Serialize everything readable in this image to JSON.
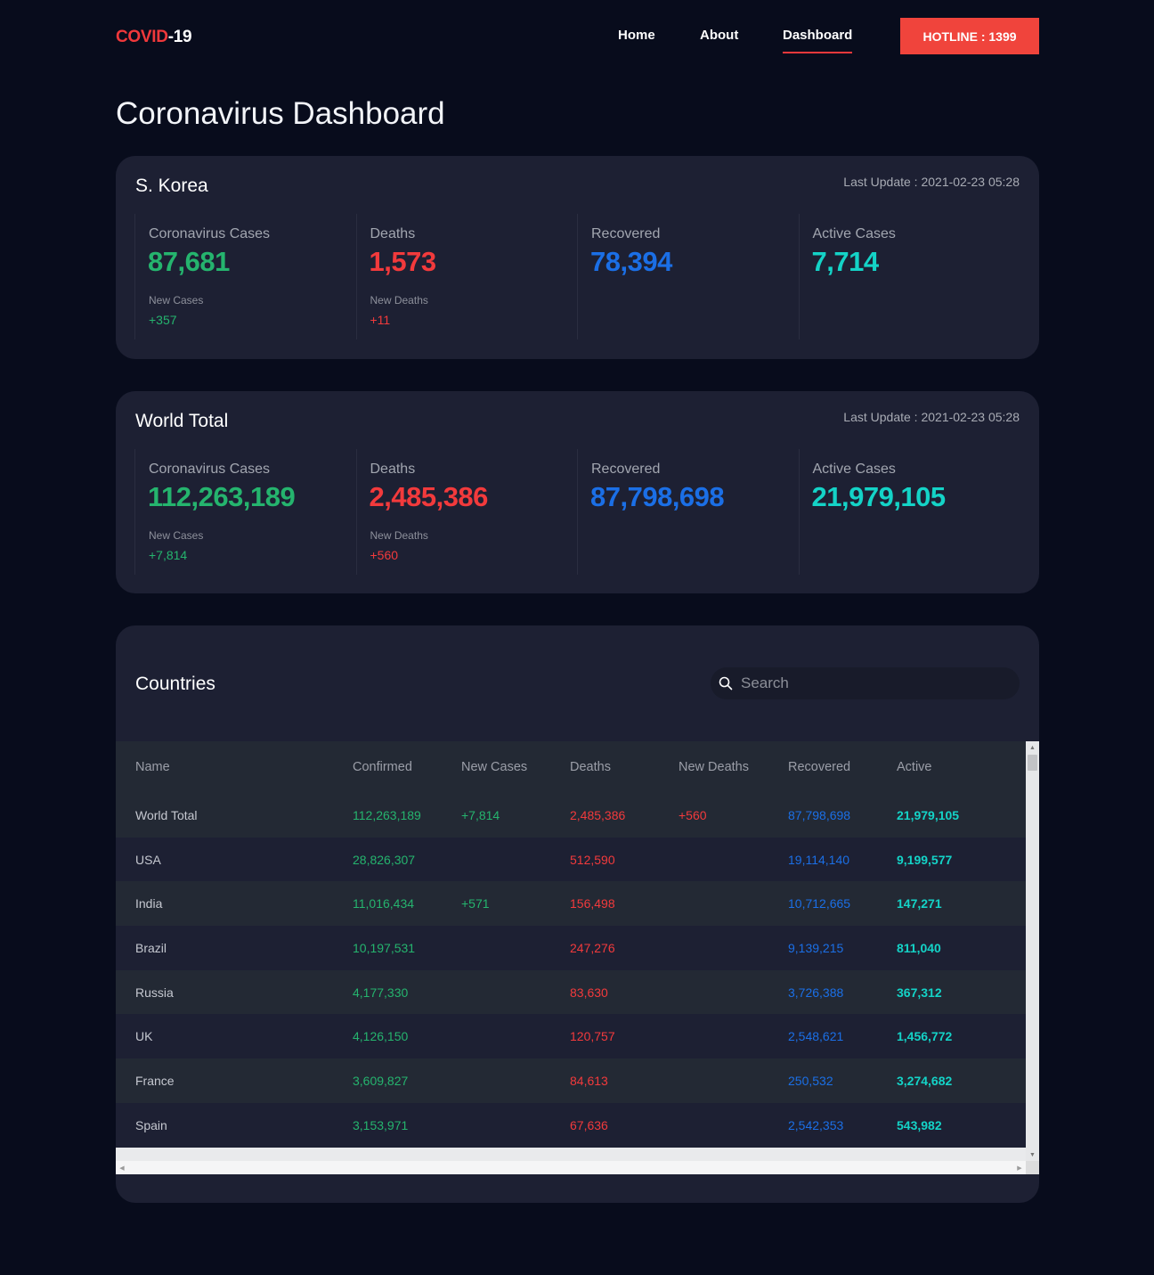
{
  "nav": {
    "logo_part1": "COVID",
    "logo_part2": "-19",
    "links": [
      "Home",
      "About",
      "Dashboard"
    ],
    "hotline": "HOTLINE : 1399"
  },
  "page_title": "Coronavirus Dashboard",
  "korea": {
    "title": "S. Korea",
    "last_update": "Last Update : 2021-02-23 05:28",
    "cases_label": "Coronavirus Cases",
    "cases_value": "87,681",
    "new_cases_label": "New Cases",
    "new_cases_value": "+357",
    "deaths_label": "Deaths",
    "deaths_value": "1,573",
    "new_deaths_label": "New Deaths",
    "new_deaths_value": "+11",
    "recovered_label": "Recovered",
    "recovered_value": "78,394",
    "active_label": "Active Cases",
    "active_value": "7,714"
  },
  "world": {
    "title": "World Total",
    "last_update": "Last Update : 2021-02-23 05:28",
    "cases_label": "Coronavirus Cases",
    "cases_value": "112,263,189",
    "new_cases_label": "New Cases",
    "new_cases_value": "+7,814",
    "deaths_label": "Deaths",
    "deaths_value": "2,485,386",
    "new_deaths_label": "New Deaths",
    "new_deaths_value": "+560",
    "recovered_label": "Recovered",
    "recovered_value": "87,798,698",
    "active_label": "Active Cases",
    "active_value": "21,979,105"
  },
  "countries": {
    "title": "Countries",
    "search_placeholder": "Search",
    "columns": [
      "Name",
      "Confirmed",
      "New Cases",
      "Deaths",
      "New Deaths",
      "Recovered",
      "Active"
    ],
    "rows": [
      [
        "World Total",
        "112,263,189",
        "+7,814",
        "2,485,386",
        "+560",
        "87,798,698",
        "21,979,105"
      ],
      [
        "USA",
        "28,826,307",
        "",
        "512,590",
        "",
        "19,114,140",
        "9,199,577"
      ],
      [
        "India",
        "11,016,434",
        "+571",
        "156,498",
        "",
        "10,712,665",
        "147,271"
      ],
      [
        "Brazil",
        "10,197,531",
        "",
        "247,276",
        "",
        "9,139,215",
        "811,040"
      ],
      [
        "Russia",
        "4,177,330",
        "",
        "83,630",
        "",
        "3,726,388",
        "367,312"
      ],
      [
        "UK",
        "4,126,150",
        "",
        "120,757",
        "",
        "2,548,621",
        "1,456,772"
      ],
      [
        "France",
        "3,609,827",
        "",
        "84,613",
        "",
        "250,532",
        "3,274,682"
      ],
      [
        "Spain",
        "3,153,971",
        "",
        "67,636",
        "",
        "2,542,353",
        "543,982"
      ]
    ]
  },
  "colors": {
    "background": "#080c1c",
    "card": "#1d2033",
    "accent_red": "#f0443c",
    "green": "#25b46e",
    "red": "#f23a3c",
    "blue": "#1b6fe6",
    "cyan": "#14d3c7"
  }
}
